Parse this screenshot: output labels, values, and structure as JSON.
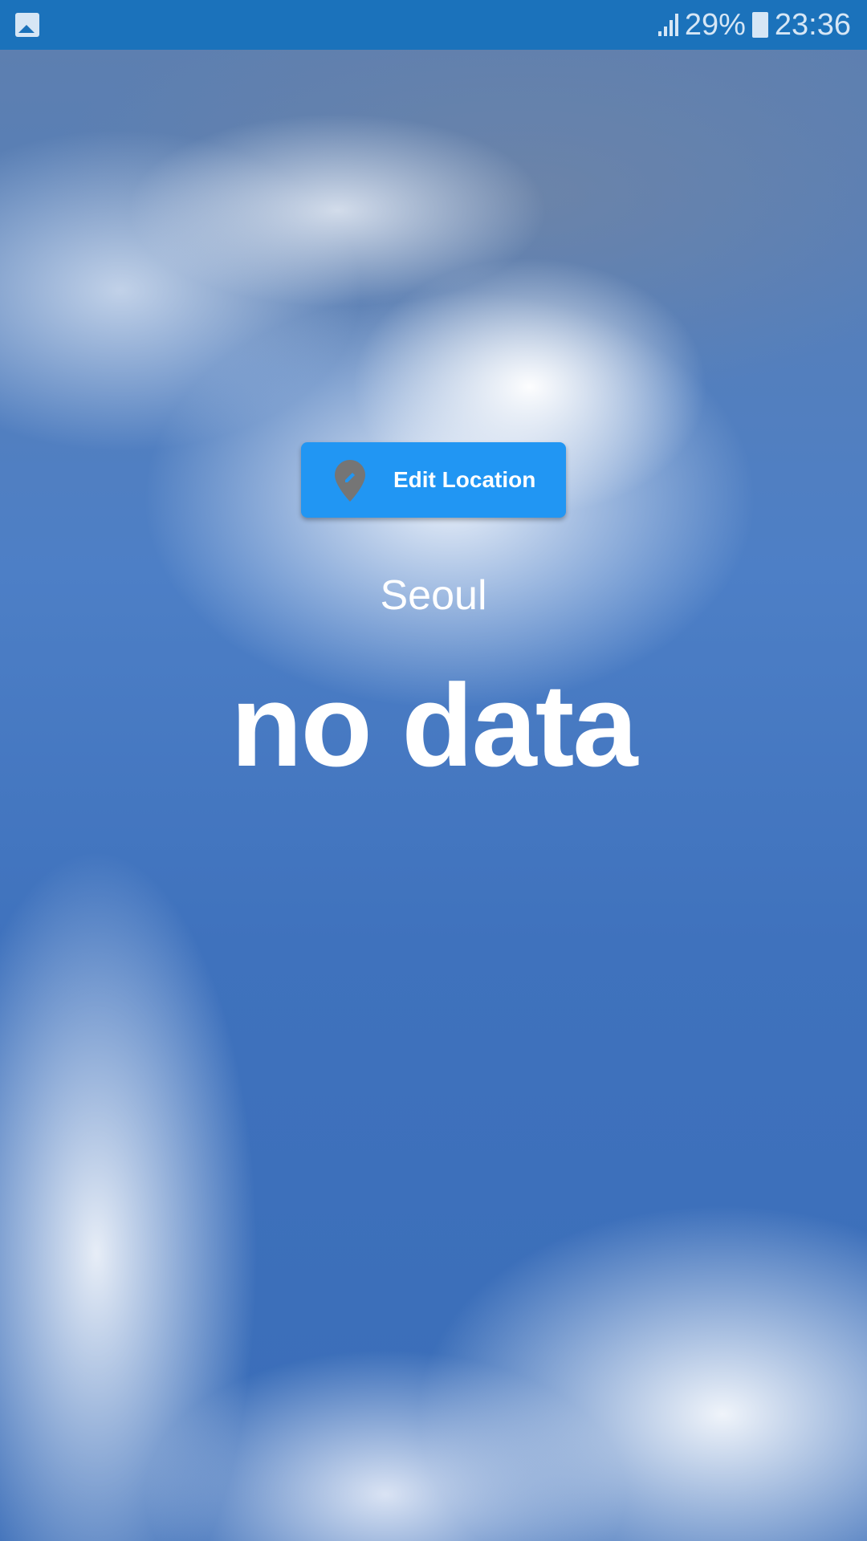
{
  "status_bar": {
    "notification_icon": "image-icon",
    "signal_icon": "signal-icon",
    "battery_percent": "29%",
    "battery_icon": "battery-charging-icon",
    "time": "23:36"
  },
  "main": {
    "edit_button": {
      "label": "Edit Location",
      "icon": "edit-location-icon"
    },
    "city": "Seoul",
    "weather_text": "no data"
  },
  "colors": {
    "status_bar": "#1b72bb",
    "button": "#2196f3",
    "pin": "#757575"
  }
}
